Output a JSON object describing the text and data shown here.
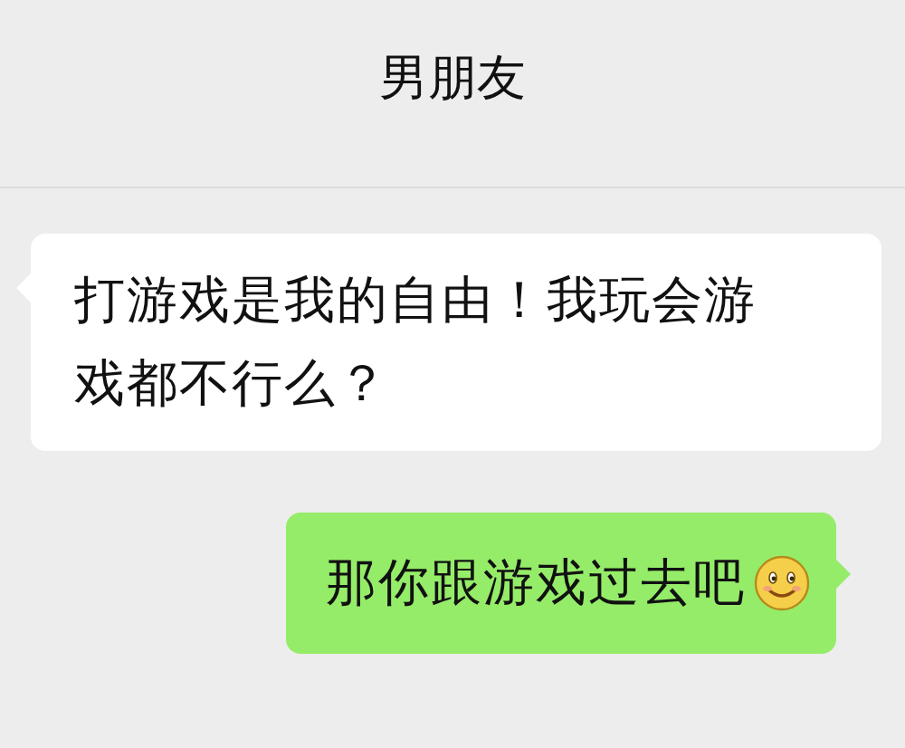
{
  "title": "男朋友",
  "messages": [
    {
      "kind": "incoming",
      "text": "打游戏是我的自由！我玩会游戏都不行么？",
      "has_emoji": false
    },
    {
      "kind": "outgoing",
      "text": "那你跟游戏过去吧",
      "has_emoji": true
    }
  ]
}
